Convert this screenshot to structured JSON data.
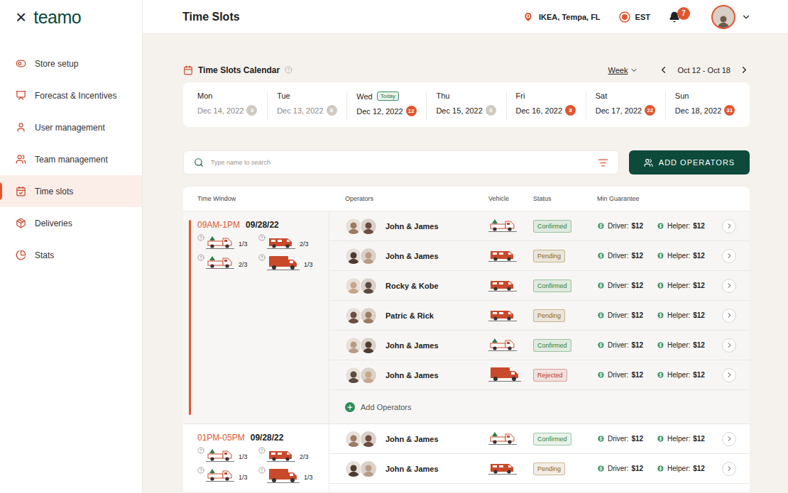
{
  "sidebar": {
    "close": "×",
    "logo": "teamo",
    "items": [
      {
        "label": "Store setup",
        "selected": false
      },
      {
        "label": "Forecast & Incentives",
        "selected": false
      },
      {
        "label": "User management",
        "selected": false
      },
      {
        "label": "Team management",
        "selected": false
      },
      {
        "label": "Time slots",
        "selected": true
      },
      {
        "label": "Deliveries",
        "selected": false
      },
      {
        "label": "Stats",
        "selected": false
      }
    ]
  },
  "header": {
    "title": "Time Slots",
    "location": "IKEA, Tempa, FL",
    "timezone": "EST",
    "notifications": "7"
  },
  "calendar": {
    "title": "Time Slots Calendar",
    "view": "Week",
    "range": "Oct 12 - Oct 18",
    "days": [
      {
        "day": "Mon",
        "date": "Dec 14, 2022",
        "count": "3",
        "tag": null,
        "selected": false,
        "past": true,
        "badge_color": "#cfc9c1"
      },
      {
        "day": "Tue",
        "date": "Dec 13, 2022",
        "count": "8",
        "tag": null,
        "selected": false,
        "past": true,
        "badge_color": "#cfc9c1"
      },
      {
        "day": "Wed",
        "date": "Dec 12, 2022",
        "count": "12",
        "tag": "Today",
        "selected": true,
        "past": false,
        "badge_color": "#e0562f"
      },
      {
        "day": "Thu",
        "date": "Dec 15, 2022",
        "count": "0",
        "tag": null,
        "selected": false,
        "past": false,
        "badge_color": "#cfc9c1"
      },
      {
        "day": "Fri",
        "date": "Dec 16, 2022",
        "count": "3",
        "tag": null,
        "selected": false,
        "past": false,
        "badge_color": "#e0562f"
      },
      {
        "day": "Sat",
        "date": "Dec 17, 2022",
        "count": "22",
        "tag": null,
        "selected": false,
        "past": false,
        "badge_color": "#e0562f"
      },
      {
        "day": "Sun",
        "date": "Dec 18, 2022",
        "count": "31",
        "tag": null,
        "selected": false,
        "past": false,
        "badge_color": "#e0562f"
      }
    ]
  },
  "search": {
    "placeholder": "Type name to search"
  },
  "add_button": "ADD OPERATORS",
  "table": {
    "columns": [
      "Time Window",
      "Operators",
      "Vehicle",
      "Status",
      "Min Guarantee"
    ],
    "groups": [
      {
        "time": "09AM-1PM",
        "date": "09/28/22",
        "selected": true,
        "capacity": [
          {
            "vehicle": "pickup",
            "count": "1/3"
          },
          {
            "vehicle": "van",
            "count": "2/3"
          },
          {
            "vehicle": "pickup",
            "count": "2/3"
          },
          {
            "vehicle": "truck",
            "count": "1/3"
          }
        ],
        "rows": [
          {
            "operators": "John & James",
            "vehicle": "pickup",
            "status": "Confirmed",
            "status_color": "#2e8540",
            "driver_label": "Driver:",
            "driver": "$12",
            "helper_label": "Helper:",
            "helper": "$12"
          },
          {
            "operators": "John & James",
            "vehicle": "van",
            "status": "Pending",
            "status_color": "#946612",
            "driver_label": "Driver:",
            "driver": "$12",
            "helper_label": "Helper:",
            "helper": "$12"
          },
          {
            "operators": "Rocky & Kobe",
            "vehicle": "van",
            "status": "Confirmed",
            "status_color": "#2e8540",
            "driver_label": "Driver:",
            "driver": "$12",
            "helper_label": "Helper:",
            "helper": "$12"
          },
          {
            "operators": "Patric & Rick",
            "vehicle": "van",
            "status": "Pending",
            "status_color": "#946612",
            "driver_label": "Driver:",
            "driver": "$12",
            "helper_label": "Helper:",
            "helper": "$12"
          },
          {
            "operators": "John & James",
            "vehicle": "pickup",
            "status": "Confirmed",
            "status_color": "#2e8540",
            "driver_label": "Driver:",
            "driver": "$12",
            "helper_label": "Helper:",
            "helper": "$12"
          },
          {
            "operators": "John & James",
            "vehicle": "truck",
            "status": "Rejected",
            "status_color": "#c0392b",
            "driver_label": "Driver:",
            "driver": "$12",
            "helper_label": "Helper:",
            "helper": "$12"
          }
        ],
        "add": "Add Operators"
      },
      {
        "time": "01PM-05PM",
        "date": "09/28/22",
        "selected": false,
        "capacity": [
          {
            "vehicle": "pickup",
            "count": "1/3"
          },
          {
            "vehicle": "van",
            "count": "2/3"
          },
          {
            "vehicle": "pickup",
            "count": "1/3"
          },
          {
            "vehicle": "truck",
            "count": "1/3"
          }
        ],
        "rows": [
          {
            "operators": "John & James",
            "vehicle": "pickup",
            "status": "Confirmed",
            "status_color": "#2e8540",
            "driver_label": "Driver:",
            "driver": "$12",
            "helper_label": "Helper:",
            "helper": "$12"
          },
          {
            "operators": "John & James",
            "vehicle": "van",
            "status": "Pending",
            "status_color": "#946612",
            "driver_label": "Driver:",
            "driver": "$12",
            "helper_label": "Helper:",
            "helper": "$12"
          }
        ],
        "add": null
      }
    ]
  }
}
